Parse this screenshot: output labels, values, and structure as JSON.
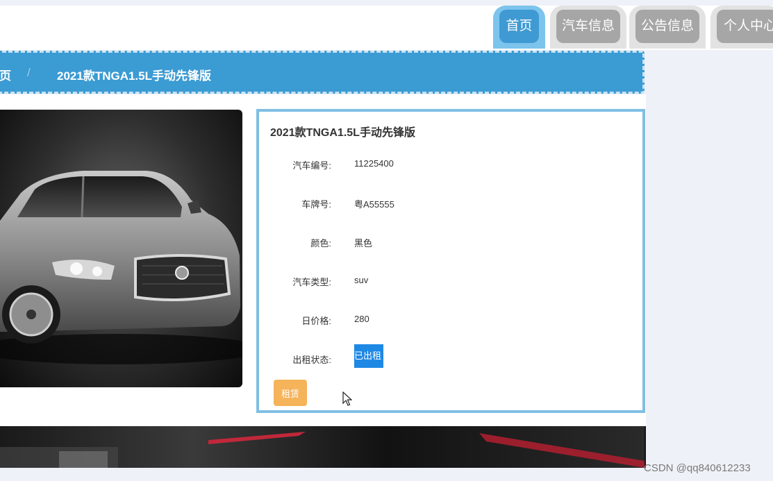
{
  "nav": {
    "tabs": [
      {
        "label": "首页",
        "active": true
      },
      {
        "label": "汽车信息",
        "active": false
      },
      {
        "label": "公告信息",
        "active": false
      },
      {
        "label": "个人中心",
        "active": false
      }
    ]
  },
  "breadcrumb": {
    "home": "页",
    "separator": "/",
    "current": "2021款TNGA1.5L手动先锋版"
  },
  "product": {
    "title": "2021款TNGA1.5L手动先锋版",
    "fields": [
      {
        "label": "汽车编号:",
        "value": "11225400"
      },
      {
        "label": "车牌号:",
        "value": "粤A55555"
      },
      {
        "label": "颜色:",
        "value": "黑色"
      },
      {
        "label": "汽车类型:",
        "value": "suv"
      },
      {
        "label": "日价格:",
        "value": "280"
      },
      {
        "label": "出租状态:",
        "value": "已出租"
      }
    ],
    "rent_button": "租赁"
  },
  "watermark": "CSDN @qq840612233",
  "colors": {
    "primary": "#3b9bd3",
    "nav_active": "#3f9ad3",
    "nav_inactive": "#a6a6a6",
    "rent_button": "#f5b35a",
    "status_highlight": "#1e88e5"
  }
}
